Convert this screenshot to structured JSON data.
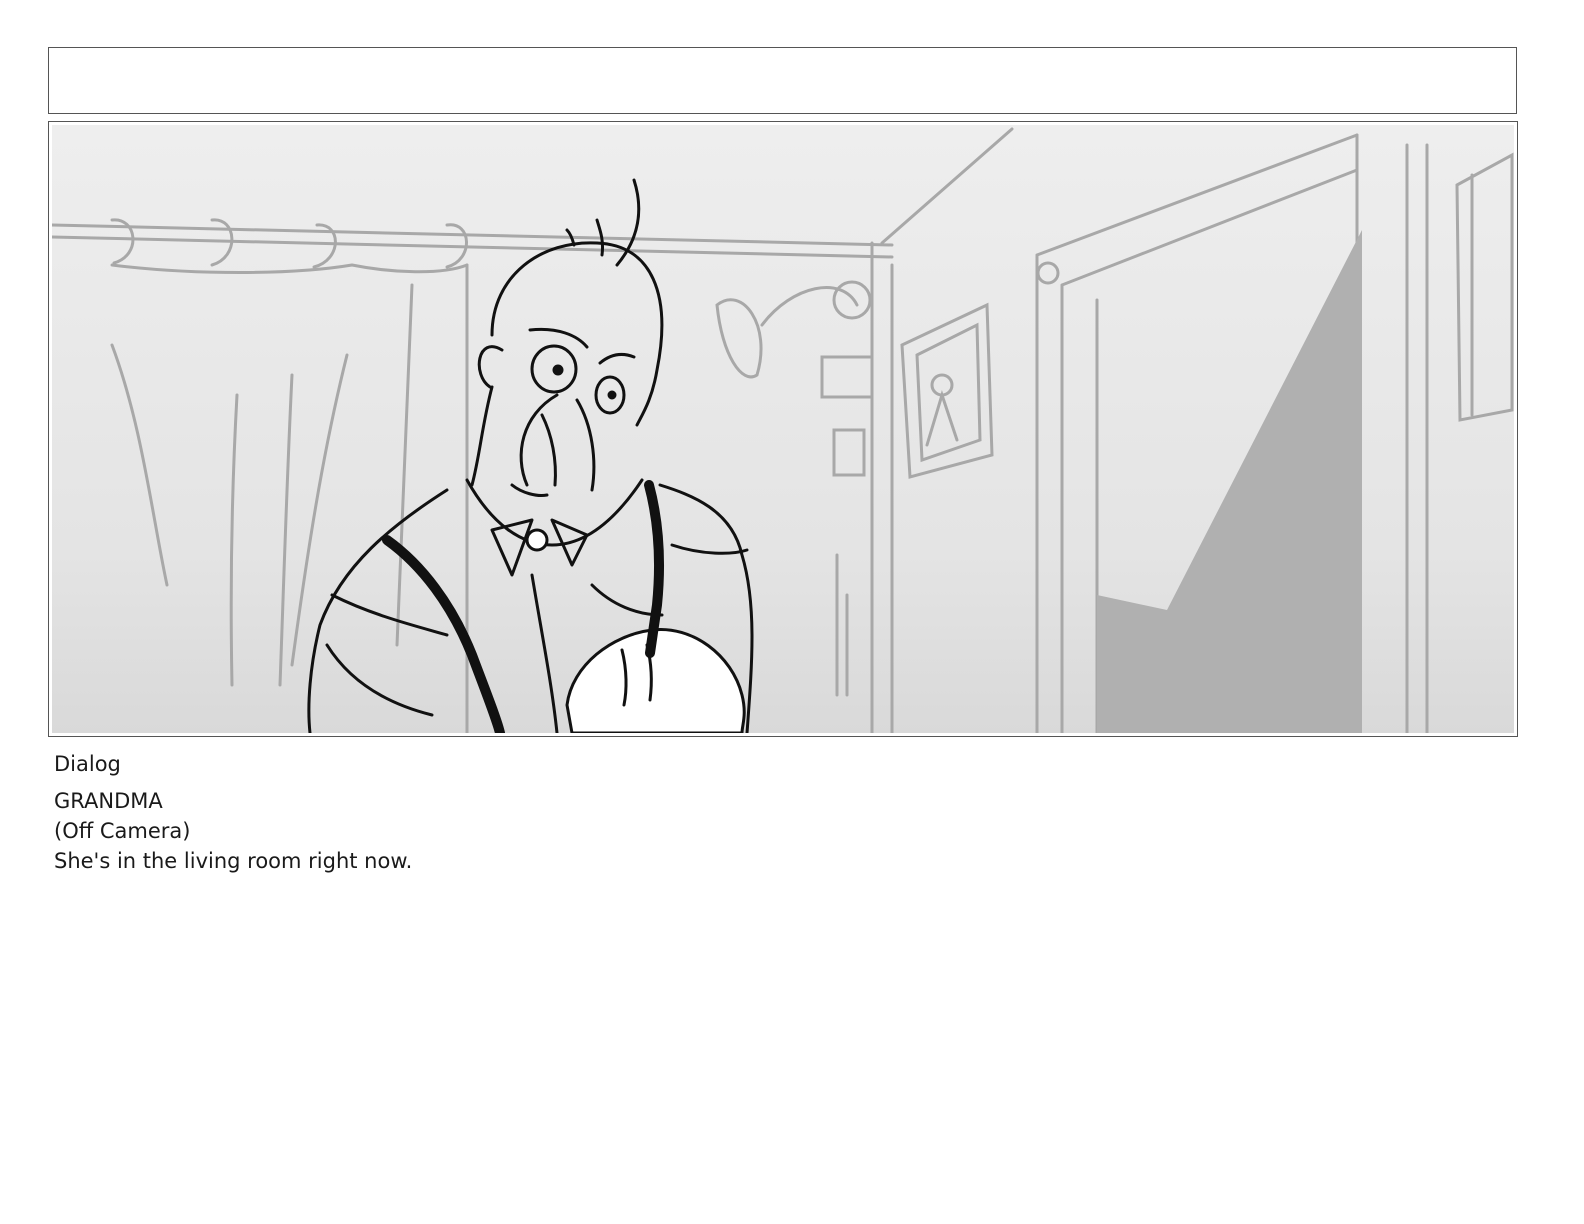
{
  "header": {
    "text": ""
  },
  "panel": {
    "scene": "storyboard-sketch"
  },
  "notes": {
    "section_label": "Dialog",
    "character": "GRANDMA",
    "parenthetical": "(Off Camera)",
    "line": "She's in the living room right now."
  },
  "colors": {
    "frame_border": "#555555",
    "sketch_light": "#a8a8a8",
    "sketch_dark": "#111111",
    "doorway_shadow": "#b0b0b0"
  }
}
